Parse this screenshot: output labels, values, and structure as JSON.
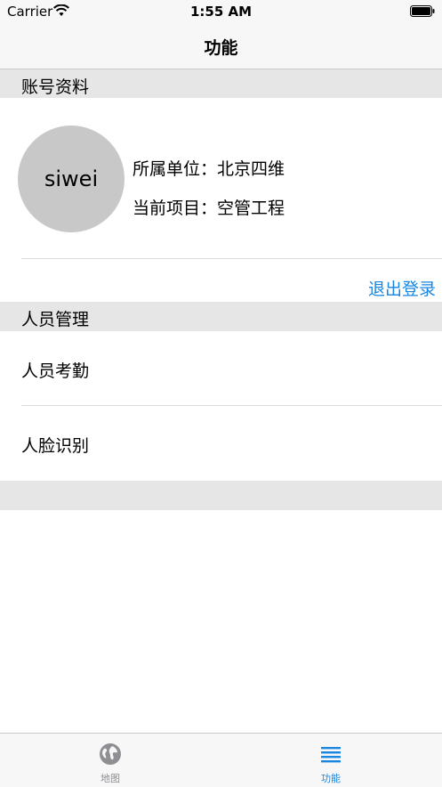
{
  "status_bar": {
    "carrier": "Carrier",
    "time": "1:55 AM"
  },
  "nav": {
    "title": "功能"
  },
  "account_section": {
    "header": "账号资料",
    "avatar_text": "siwei",
    "unit_line": "所属单位：北京四维",
    "project_line": "当前项目：空管工程",
    "logout_label": "退出登录"
  },
  "personnel_section": {
    "header": "人员管理",
    "items": [
      {
        "label": "人员考勤"
      },
      {
        "label": "人脸识别"
      }
    ]
  },
  "tab_bar": {
    "tabs": [
      {
        "label": "地图",
        "icon": "globe-icon",
        "active": false
      },
      {
        "label": "功能",
        "icon": "list-icon",
        "active": true
      }
    ]
  },
  "colors": {
    "accent": "#1a86e0",
    "inactive": "#8e8e93",
    "section_bg": "#e6e6e6",
    "avatar_bg": "#c8c8c8"
  }
}
